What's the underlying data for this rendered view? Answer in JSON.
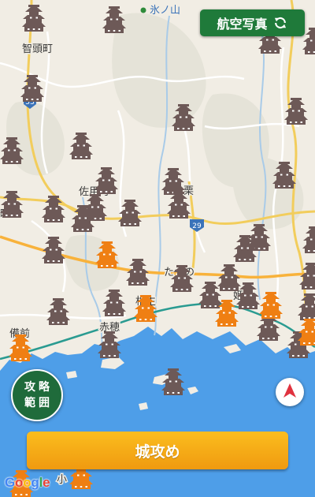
{
  "header": {
    "aerial_button_label": "航空写真",
    "aerial_button_icon": "refresh-icon"
  },
  "map": {
    "labels": {
      "hyonosen": "氷ノ山",
      "chizu": "智頭町",
      "sayo": "佐用町",
      "kuri": "栗",
      "tatsuno": "たつの",
      "aioi": "相生",
      "ako": "赤穂",
      "bizen": "備前",
      "himeji": "姫",
      "left_edge": "町",
      "ko": "小",
      "route_53": "53",
      "route_29": "29"
    },
    "colors": {
      "land": "#f1ede4",
      "sea": "#4e9ee8",
      "forest": "#e4e2d7",
      "road_main": "#f2cd5c",
      "rail": "#2a9b91",
      "castle_default": "#6d5957",
      "castle_target": "#ef7f13"
    }
  },
  "controls": {
    "attack_range_line1": "攻略",
    "attack_range_line2": "範囲",
    "compass_icon": "north-arrow-icon",
    "main_button_label": "城攻め"
  },
  "attribution": {
    "google_letters": [
      "G",
      "o",
      "o",
      "g",
      "l",
      "e"
    ],
    "google_colors": [
      "#4285F4",
      "#EA4335",
      "#FBBC05",
      "#4285F4",
      "#34A853",
      "#EA4335"
    ]
  }
}
